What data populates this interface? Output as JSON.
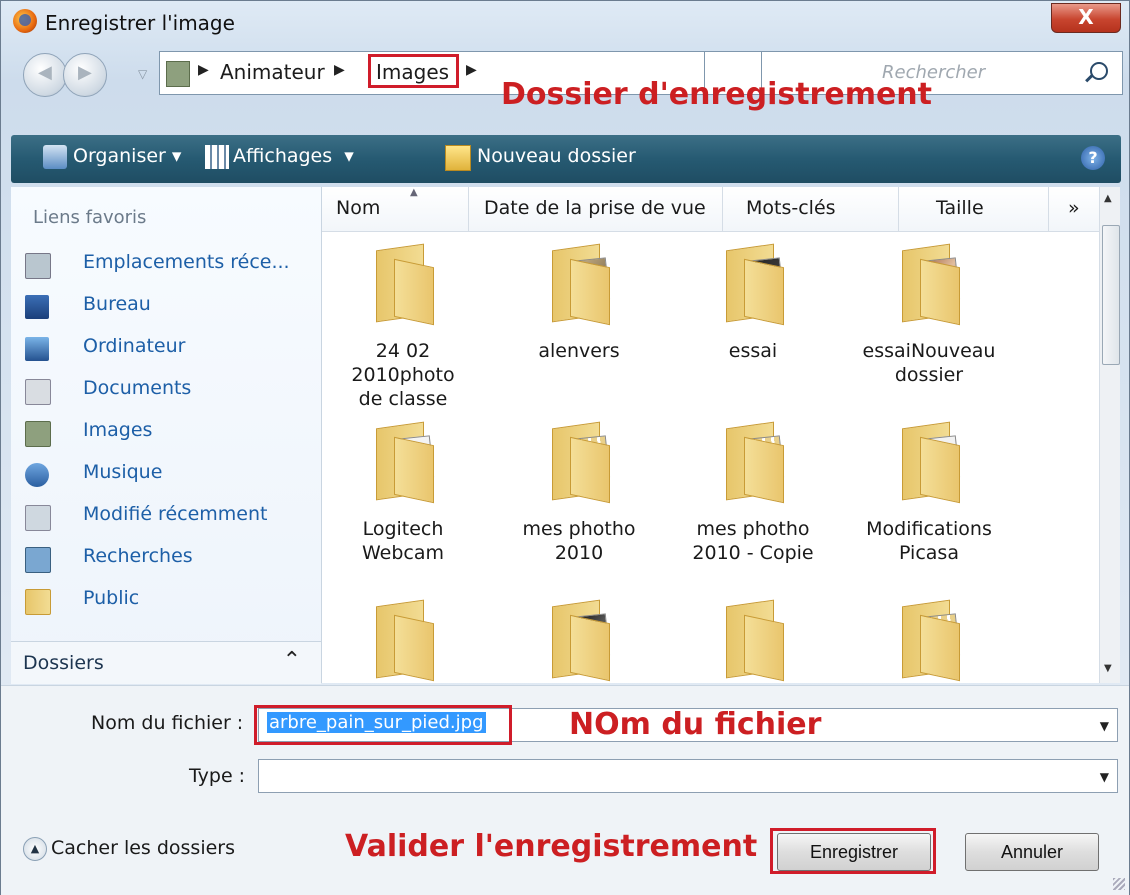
{
  "window": {
    "title": "Enregistrer l'image",
    "close_label": "X"
  },
  "address": {
    "crumbs": [
      "Animateur",
      "Images"
    ],
    "search_placeholder": "Rechercher"
  },
  "annotations": {
    "folder": "Dossier d'enregistrement",
    "filename": "NOm du fichier",
    "validate": "Valider l'enregistrement",
    "color": "#cc1f22"
  },
  "toolbar": {
    "organize": "Organiser",
    "views": "Affichages",
    "new_folder": "Nouveau dossier",
    "help": "?"
  },
  "nav": {
    "header": "Liens favoris",
    "items": [
      {
        "label": "Emplacements réce...",
        "icon": "recent-places-icon"
      },
      {
        "label": "Bureau",
        "icon": "desktop-icon"
      },
      {
        "label": "Ordinateur",
        "icon": "computer-icon"
      },
      {
        "label": "Documents",
        "icon": "documents-icon"
      },
      {
        "label": "Images",
        "icon": "pictures-icon"
      },
      {
        "label": "Musique",
        "icon": "music-icon"
      },
      {
        "label": "Modifié récemment",
        "icon": "recently-changed-icon"
      },
      {
        "label": "Recherches",
        "icon": "searches-icon"
      },
      {
        "label": "Public",
        "icon": "public-folder-icon"
      }
    ],
    "folders_label": "Dossiers"
  },
  "columns": [
    "Nom",
    "Date de la prise de vue",
    "Mots-clés",
    "Taille",
    "»"
  ],
  "folders": [
    {
      "line1": "24 02 2010photo",
      "line2": "de classe"
    },
    {
      "line1": "alenvers",
      "line2": ""
    },
    {
      "line1": "essai",
      "line2": ""
    },
    {
      "line1": "essaiNouveau",
      "line2": "dossier"
    },
    {
      "line1": "Logitech",
      "line2": "Webcam"
    },
    {
      "line1": "mes photho",
      "line2": "2010"
    },
    {
      "line1": "mes photho",
      "line2": "2010 - Copie"
    },
    {
      "line1": "Modifications",
      "line2": "Picasa"
    },
    {
      "line1": "",
      "line2": ""
    },
    {
      "line1": "",
      "line2": ""
    },
    {
      "line1": "",
      "line2": ""
    },
    {
      "line1": "",
      "line2": ""
    }
  ],
  "form": {
    "filename_label": "Nom du fichier :",
    "filename_value": "arbre_pain_sur_pied.jpg",
    "type_label": "Type :",
    "type_value": ""
  },
  "footer": {
    "hide_folders": "Cacher les dossiers",
    "save": "Enregistrer",
    "cancel": "Annuler"
  }
}
